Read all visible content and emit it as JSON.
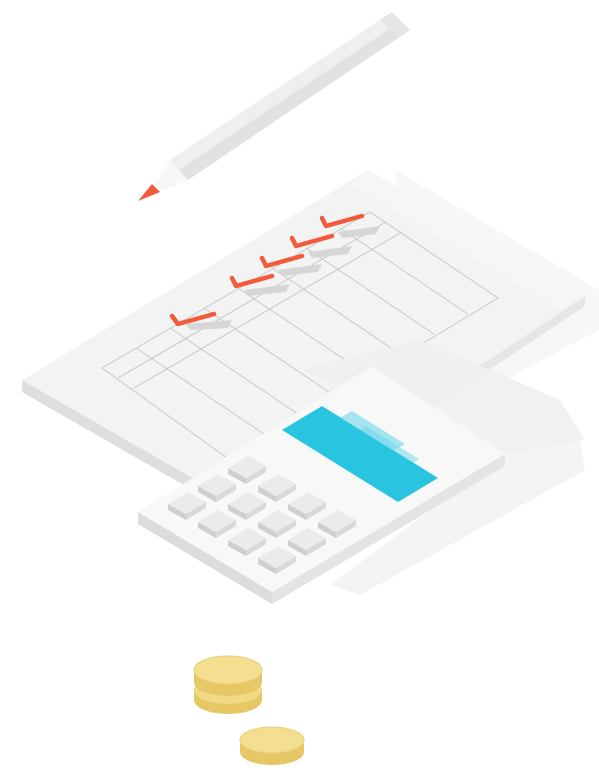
{
  "scene": {
    "kind": "isometric-illustration",
    "objects": [
      "pencil",
      "checklist-paper",
      "calculator",
      "coin-stack"
    ],
    "checkmark_count": 5,
    "keypad_rows": 4,
    "coin_count": 3
  },
  "colors": {
    "background": "#ffffff",
    "paper_top": "#f3f3f3",
    "paper_edge": "#dcdcdc",
    "paper_side": "#e8e8e8",
    "grid_line": "#c9c9c9",
    "check_orange": "#f15a3a",
    "check_shadow": "#d6d6d6",
    "pencil_body": "#efefef",
    "pencil_shade": "#e2e2e2",
    "pencil_tip_wood": "#f7f7f7",
    "pencil_lead": "#f15a3a",
    "calc_top": "#f7f7f7",
    "calc_side": "#e0e0e0",
    "calc_screen": "#29c4e0",
    "calc_screen_dark": "#1aa8c4",
    "key_top": "#e9e9e9",
    "key_side": "#cfcfcf",
    "coin_top": "#f3df8f",
    "coin_side": "#e6c766",
    "shadow": "#ededed"
  }
}
